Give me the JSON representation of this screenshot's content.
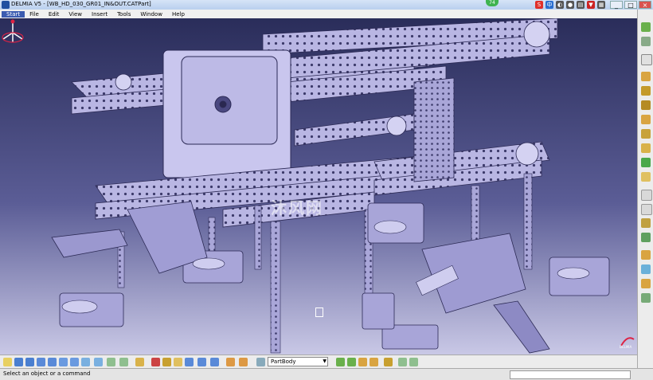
{
  "window": {
    "title": "DELMIA V5 - [WB_HD_030_GR01_IN&OUT.CATPart]"
  },
  "tray": {
    "badge": "74"
  },
  "window_controls": {
    "minimize": "_",
    "restore": "□",
    "close": "×"
  },
  "menu": {
    "items": [
      "Start",
      "File",
      "Edit",
      "View",
      "Insert",
      "Tools",
      "Window",
      "Help"
    ]
  },
  "toolbar": {
    "part_body_select": "PartBody"
  },
  "viewport": {
    "watermark": "沐风网",
    "background_top": "#2a2d5a",
    "background_bottom": "#c9c8e6",
    "part_color": "#b9b6e3"
  },
  "status": {
    "message": "Select an object or a command"
  },
  "icons": {
    "compass": "compass-icon",
    "logo": "3ds-logo-icon"
  }
}
